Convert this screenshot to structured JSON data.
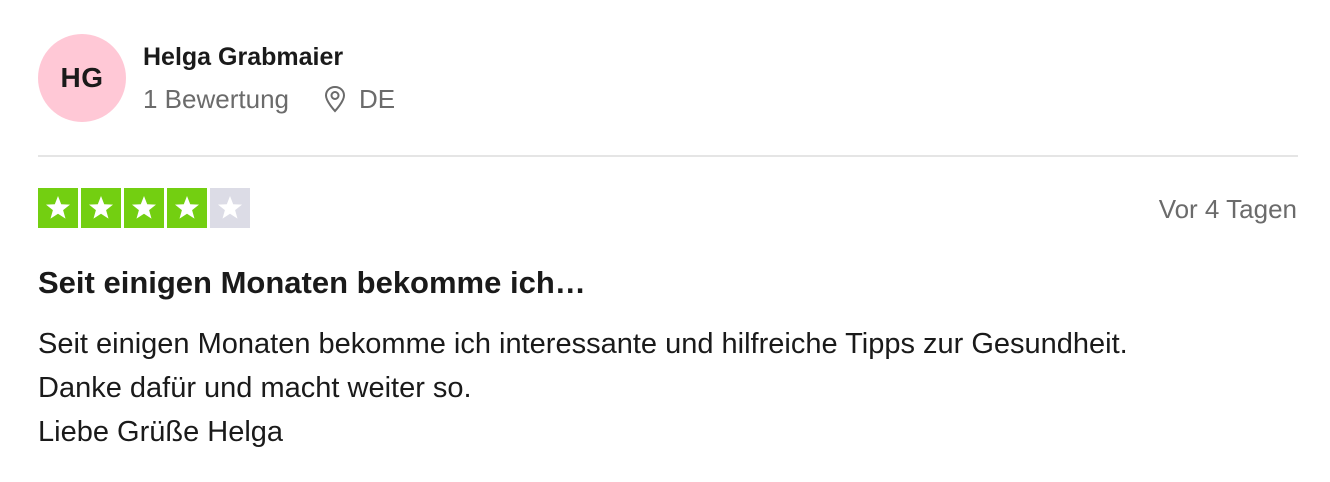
{
  "reviewer": {
    "initials": "HG",
    "avatar_color": "#ffc8d6",
    "name": "Helga Grabmaier",
    "review_count": "1 Bewertung",
    "location_icon": "location-pin-icon",
    "country": "DE"
  },
  "review": {
    "rating": 4,
    "max_rating": 5,
    "star_filled_color": "#73cf11",
    "star_empty_color": "#dcdce6",
    "date": "Vor 4 Tagen",
    "title": "Seit einigen Monaten bekomme ich…",
    "body_lines": [
      "Seit einigen Monaten bekomme ich interessante und hilfreiche Tipps zur Gesundheit.",
      "Danke dafür und macht weiter so.",
      "Liebe Grüße Helga"
    ]
  }
}
